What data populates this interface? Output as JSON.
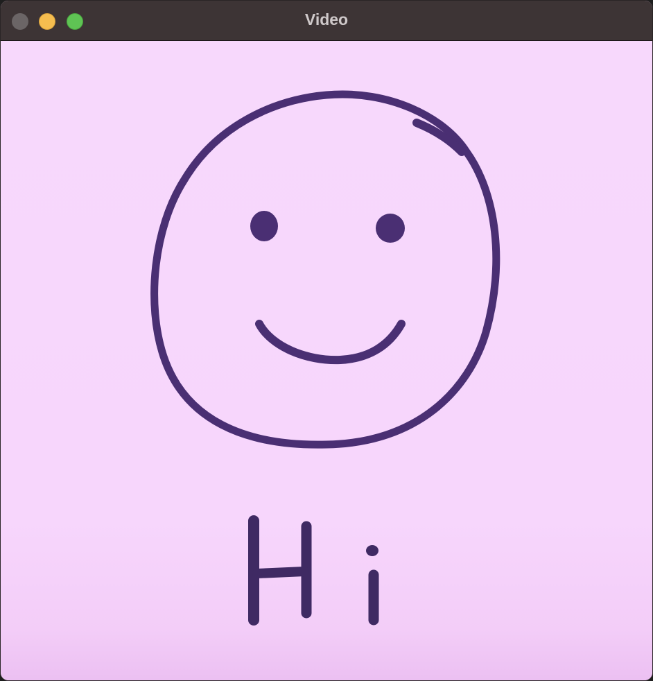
{
  "window": {
    "title": "Video"
  },
  "video_frame": {
    "drawing": "smiley-face",
    "handwritten_text": "Hi",
    "ink_color": "#4a2f73",
    "paper_color": "#f7d8fb"
  }
}
